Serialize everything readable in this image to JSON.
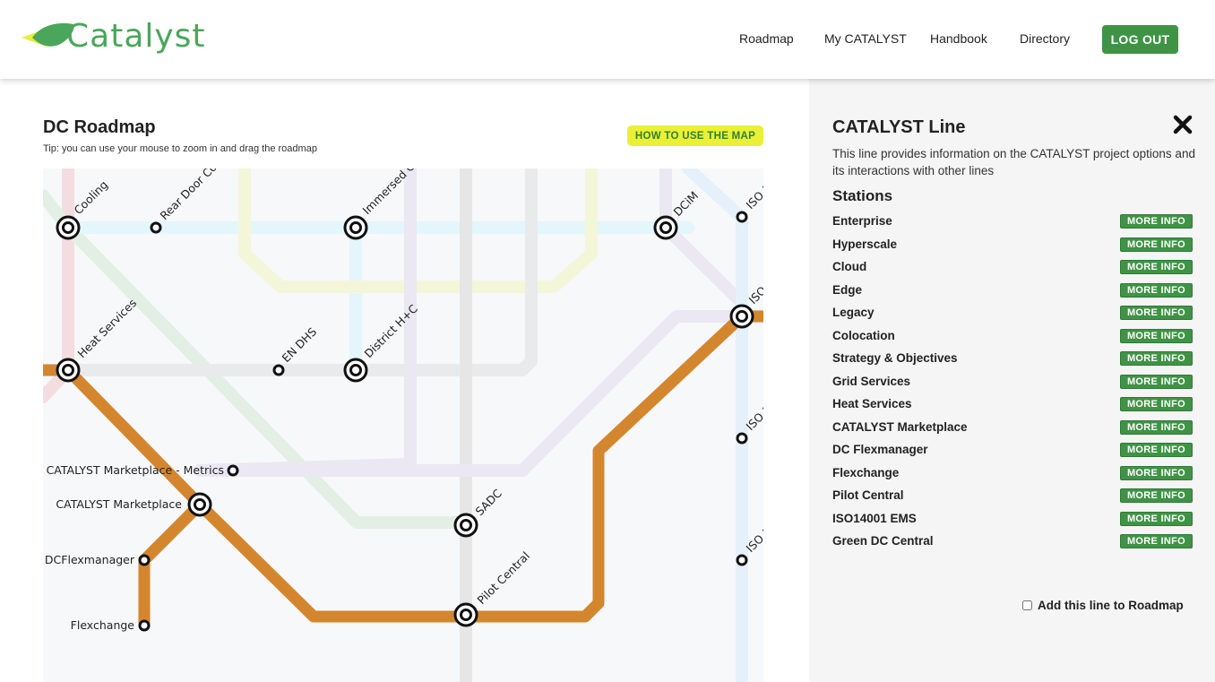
{
  "header": {
    "logo_text": "Catalyst",
    "nav": [
      "Roadmap",
      "My CATALYST",
      "Handbook",
      "Directory"
    ],
    "logout_label": "LOG OUT"
  },
  "main": {
    "title": "DC Roadmap",
    "tip": "Tip: you can use your mouse to zoom in and drag the roadmap",
    "how_to_label": "HOW TO USE THE MAP"
  },
  "map": {
    "labels": {
      "cooling": "Cooling",
      "rear_door": "Rear Door Co",
      "immersed": "Immersed C",
      "dcim": "DCiM",
      "iso_top": "ISO 1",
      "iso_mid": "ISO",
      "iso_lower": "ISO 1",
      "iso_bottom": "ISO 1",
      "heat_services": "Heat Services",
      "en_dhs": "EN DHS",
      "district": "District H+C",
      "marketplace_metrics": "CATALYST Marketplace - Metrics",
      "marketplace": "CATALYST Marketplace",
      "sadc": "SADC",
      "dcflexmanager": "DCFlexmanager",
      "pilot_central": "Pilot Central",
      "flexchange": "Flexchange"
    },
    "colors": {
      "catalyst_line": "#d4862f",
      "background": "#f7f8fa"
    }
  },
  "panel": {
    "title": "CATALYST Line",
    "description": "This line provides information on the CATALYST project options and its interactions with other lines",
    "stations_heading": "Stations",
    "stations": [
      "Enterprise",
      "Hyperscale",
      "Cloud",
      "Edge",
      "Legacy",
      "Colocation",
      "Strategy & Objectives",
      "Grid Services",
      "Heat Services",
      "CATALYST Marketplace",
      "DC Flexmanager",
      "Flexchange",
      "Pilot Central",
      "ISO14001 EMS",
      "Green DC Central"
    ],
    "more_info_label": "MORE INFO",
    "add_line_label": "Add this line to Roadmap"
  },
  "colors": {
    "brand_green": "#3f9345",
    "accent_yellow": "#eaf035"
  }
}
